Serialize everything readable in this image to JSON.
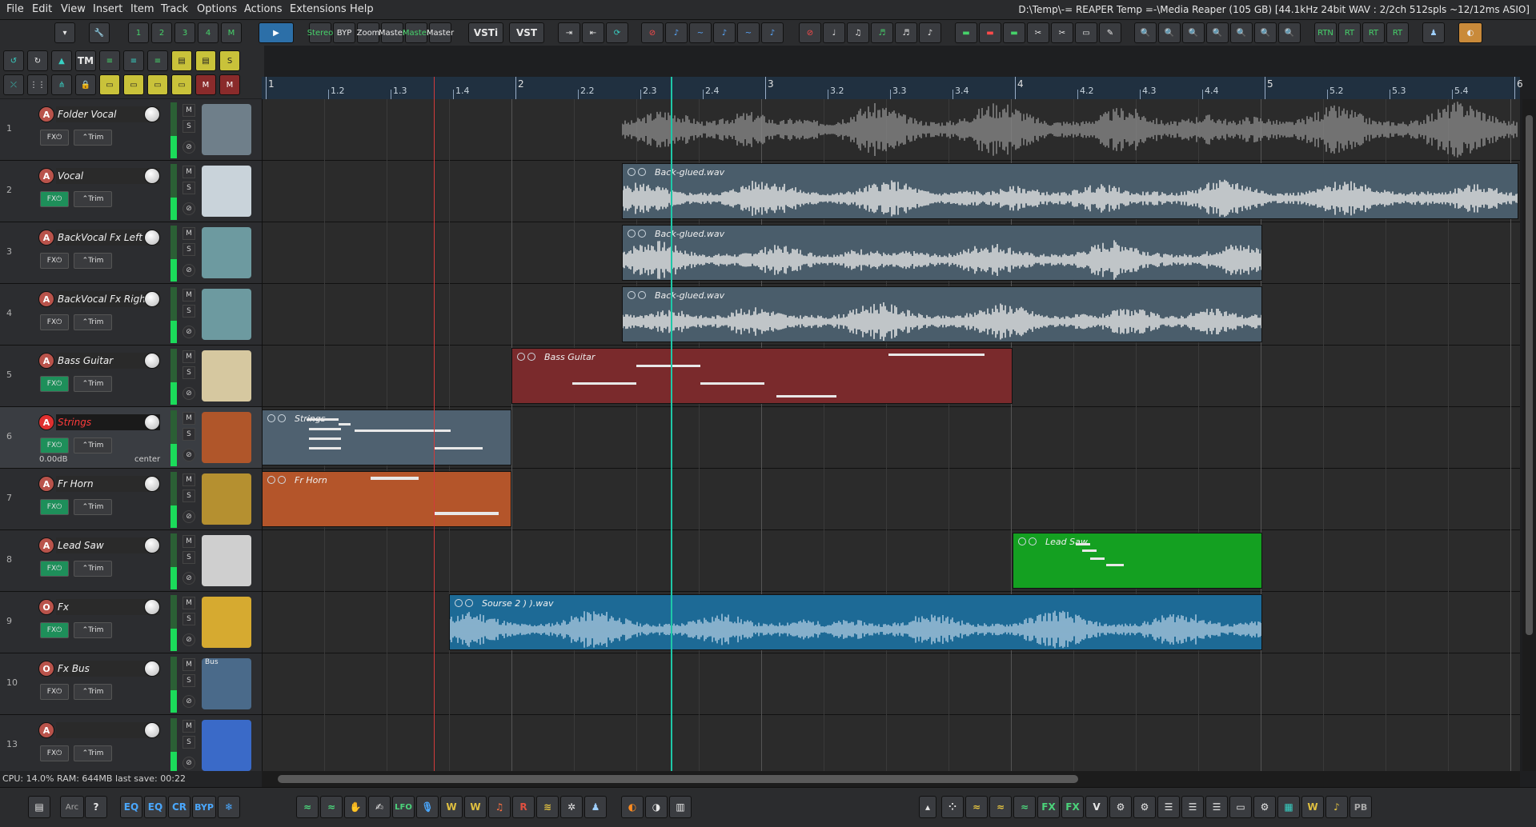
{
  "menu": [
    "File",
    "Edit",
    "View",
    "Insert",
    "Item",
    "Track",
    "Options",
    "Actions",
    "Extensions",
    "Help"
  ],
  "title": "D:\\Temp\\-= REAPER Temp =-\\Media Reaper (105 GB) [44.1kHz 24bit WAV : 2/2ch 512spls ~12/12ms ASIO]",
  "toolbar": {
    "fx_labels": [
      "FX",
      "FX",
      "FX",
      "FX",
      "FX"
    ],
    "fx_numbers": [
      "1",
      "2",
      "3",
      "4",
      "M"
    ],
    "stereo": "Stereo",
    "byp": "BYP",
    "master": "Master",
    "zoom": "Zoom",
    "vsti": "VSTi",
    "vst": "VST",
    "tm": "TM",
    "rt_buttons": [
      "RTN",
      "RT",
      "RT",
      "RT"
    ]
  },
  "ruler": {
    "labels": [
      "1",
      "1.2",
      "1.3",
      "1.4",
      "2",
      "2.2",
      "2.3",
      "2.4",
      "3",
      "3.2",
      "3.3",
      "3.4",
      "4",
      "4.2",
      "4.3",
      "4.4",
      "5",
      "5.2",
      "5.3",
      "5.4",
      "6"
    ]
  },
  "tracks": [
    {
      "num": "1",
      "name": "Folder Vocal",
      "fx_active": false,
      "arm": "A",
      "thumb": "choir"
    },
    {
      "num": "2",
      "name": "Vocal",
      "fx_active": true,
      "arm": "A",
      "thumb": "singer"
    },
    {
      "num": "3",
      "name": "BackVocal Fx Left",
      "fx_active": false,
      "arm": "A",
      "thumb": "headphones"
    },
    {
      "num": "4",
      "name": "BackVocal Fx Right",
      "fx_active": false,
      "arm": "A",
      "thumb": "headphones"
    },
    {
      "num": "5",
      "name": "Bass Guitar",
      "fx_active": true,
      "arm": "A",
      "thumb": "guitar"
    },
    {
      "num": "6",
      "name": "Strings",
      "fx_active": true,
      "arm": "A",
      "thumb": "cello",
      "selected": true,
      "vol": "0.00dB",
      "pan": "center"
    },
    {
      "num": "7",
      "name": "Fr Horn",
      "fx_active": true,
      "arm": "A",
      "thumb": "horn"
    },
    {
      "num": "8",
      "name": "Lead Saw",
      "fx_active": true,
      "arm": "A",
      "thumb": "keyboard"
    },
    {
      "num": "9",
      "name": "Fx",
      "fx_active": true,
      "arm": "O",
      "thumb": "wave"
    },
    {
      "num": "10",
      "name": "Fx Bus",
      "fx_active": false,
      "arm": "O",
      "thumb": "rack",
      "thumb_label": "Bus"
    },
    {
      "num": "13",
      "name": "",
      "fx_active": false,
      "arm": "A",
      "thumb": "flare"
    }
  ],
  "track_buttons": {
    "fx": "FX",
    "trim": "Trim",
    "mute": "M",
    "solo": "S"
  },
  "items": {
    "vocal": "Back-glued.wav",
    "bv_left": "Back-glued.wav",
    "bv_right": "Back-glued.wav",
    "bass": "Bass Guitar",
    "strings": "Strings",
    "horn": "Fr Horn",
    "lead": "Lead Saw",
    "fx": "Sourse 2 ) ).wav"
  },
  "colors": {
    "audio_item": "#4a5d6b",
    "bass_item": "#7a2a2c",
    "strings_item": "#4f6170",
    "horn_item": "#b4552a",
    "lead_item": "#14a021",
    "fx_item": "#1d6a96",
    "play_cursor": "#1ec7a8",
    "edit_cursor": "#d23b3b"
  },
  "status": "CPU: 14.0%  RAM: 644MB  last save: 00:22",
  "bottom": {
    "arc": "Arc",
    "eq1": "EQ",
    "eq2": "EQ",
    "cr": "CR",
    "byp": "BYP",
    "lfo": "LFO",
    "pb": "PB"
  }
}
